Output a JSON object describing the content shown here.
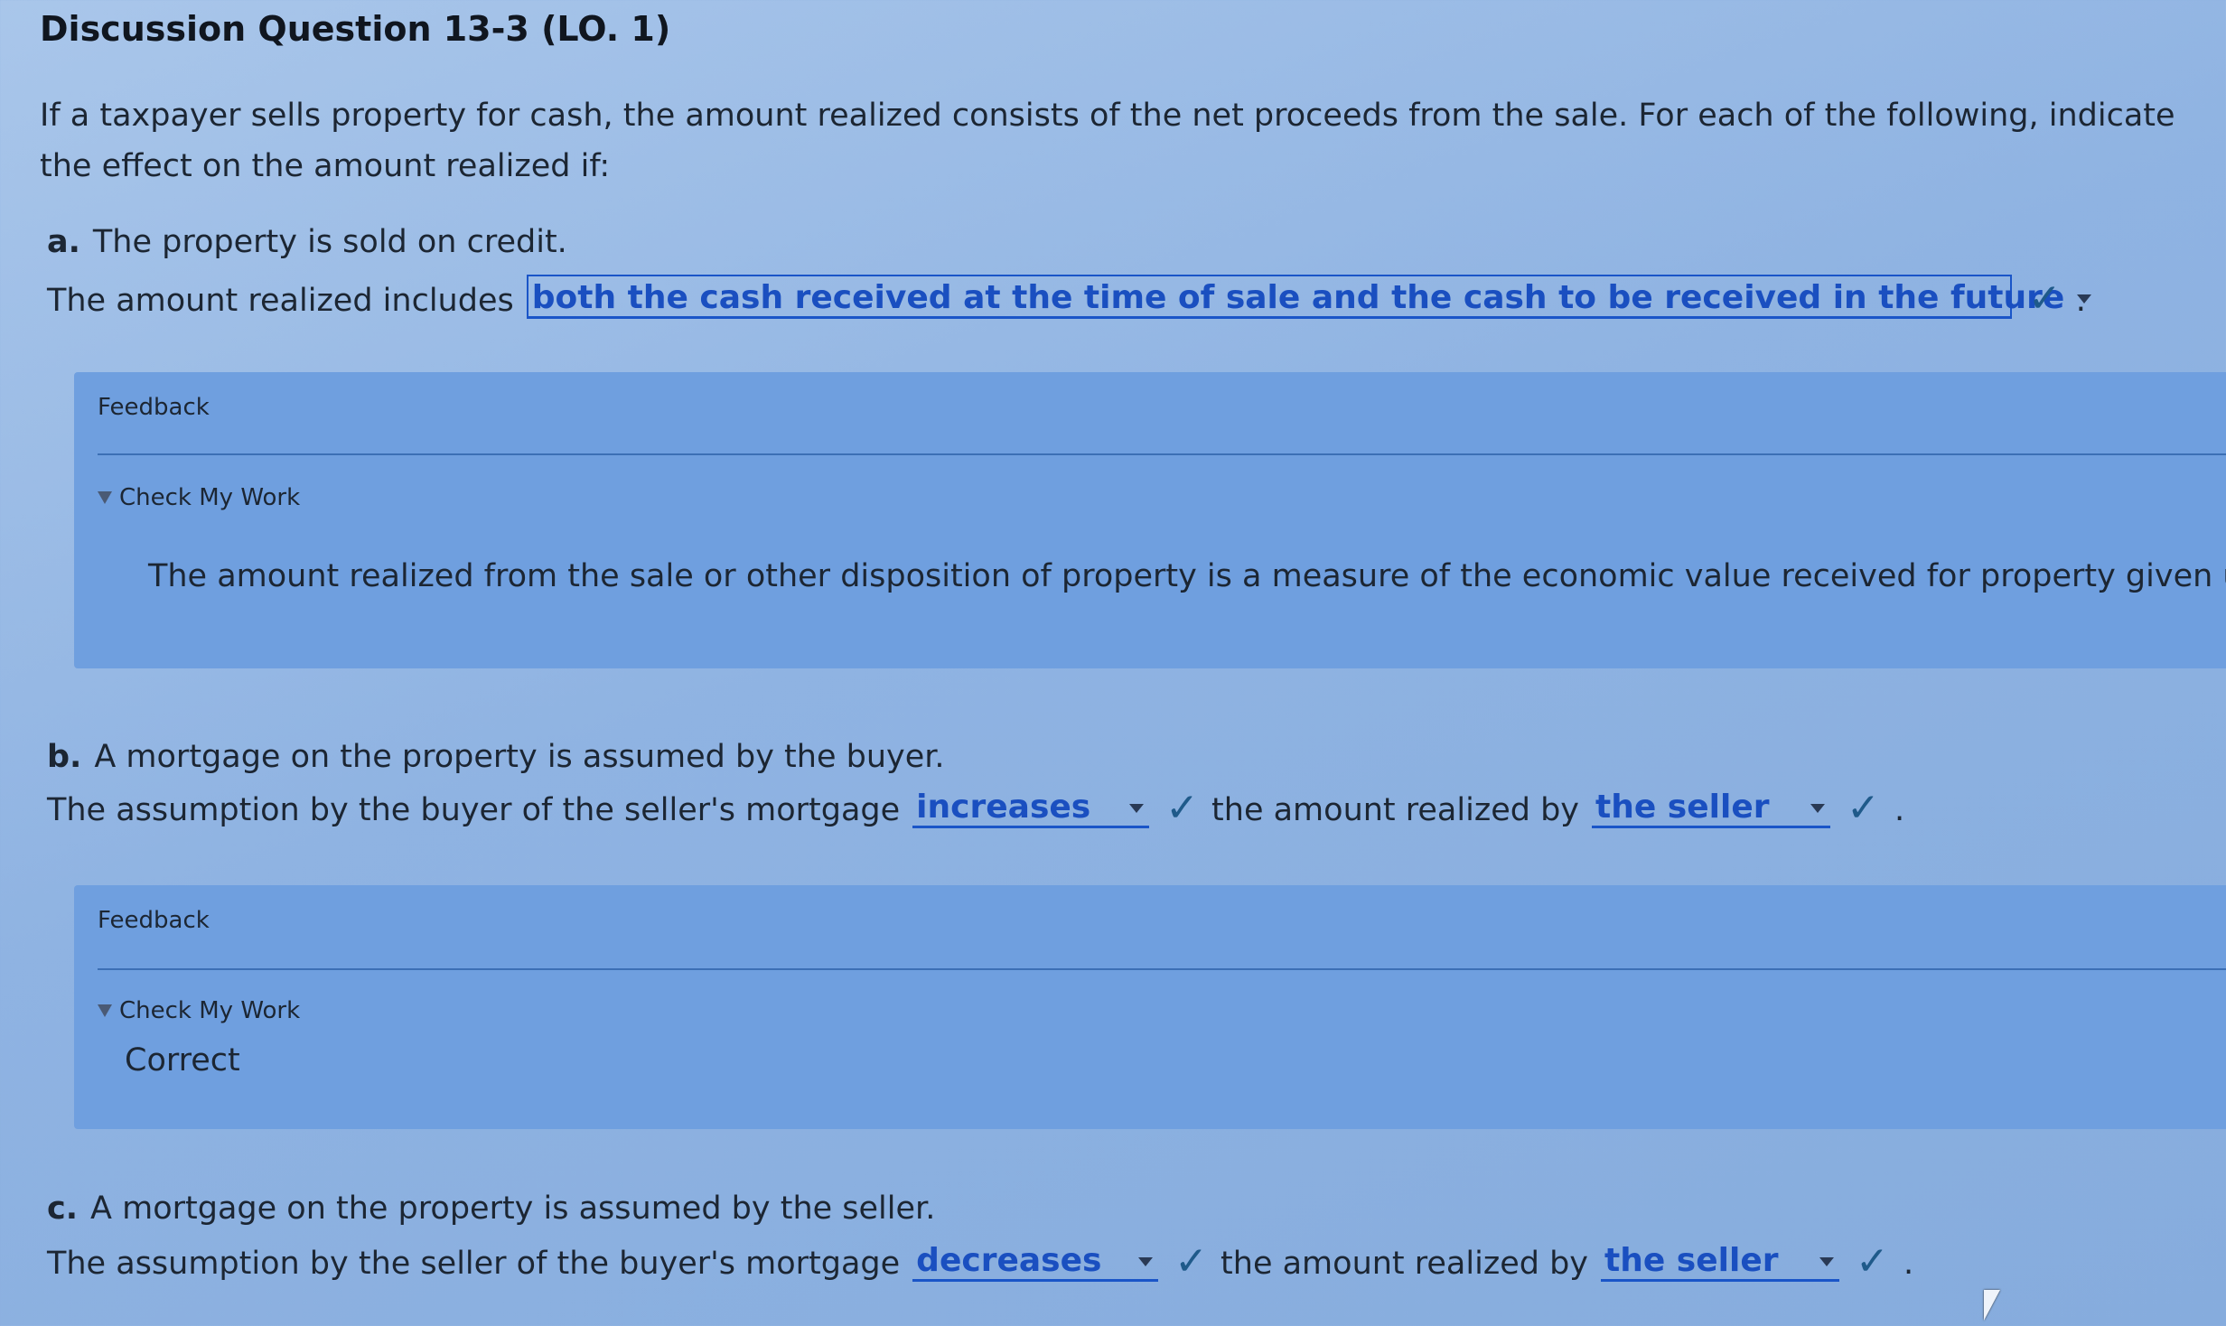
{
  "title": "Discussion Question 13-3 (LO. 1)",
  "intro": "If a taxpayer sells property for cash, the amount realized consists of the net proceeds from the sale. For each of the following, indicate the effect on the amount realized if:",
  "parts": [
    {
      "letter": "a.",
      "question": "The property is sold on credit.",
      "prefix": "The amount realized includes",
      "dropdown1": "both the cash received at the time of sale and the cash to be received in the future",
      "suffix": ".",
      "feedback_title": "Feedback",
      "check_label": "Check My Work",
      "feedback_text": "The amount realized from the sale or other disposition of property is a measure of the economic value received for property given up."
    },
    {
      "letter": "b.",
      "question": "A mortgage on the property is assumed by the buyer.",
      "prefix": "The assumption by the buyer of the seller's mortgage",
      "dropdown1": "increases",
      "middle": "the amount realized by",
      "dropdown2": "the seller",
      "suffix": ".",
      "feedback_title": "Feedback",
      "check_label": "Check My Work",
      "feedback_text": "Correct"
    },
    {
      "letter": "c.",
      "question": "A mortgage on the property is assumed by the seller.",
      "prefix": "The assumption by the seller of the buyer's mortgage",
      "dropdown1": "decreases",
      "middle": "the amount realized by",
      "dropdown2": "the seller",
      "suffix": "."
    }
  ],
  "check_symbol": "✓",
  "colors": {
    "accent": "#1a4fc0",
    "feedback_bg": "#6f9fdf",
    "check": "#1f5a8a"
  }
}
